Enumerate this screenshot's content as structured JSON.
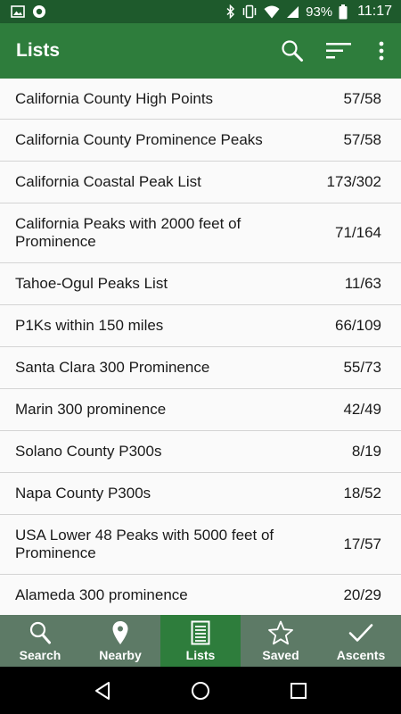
{
  "status_bar": {
    "battery": "93%",
    "time": "11:17"
  },
  "app_bar": {
    "title": "Lists"
  },
  "lists": [
    {
      "name": "California County High Points",
      "count": "57/58"
    },
    {
      "name": "California County Prominence Peaks",
      "count": "57/58"
    },
    {
      "name": "California Coastal Peak List",
      "count": "173/302"
    },
    {
      "name": "California Peaks with 2000 feet of Prominence",
      "count": "71/164"
    },
    {
      "name": "Tahoe-Ogul Peaks List",
      "count": "11/63"
    },
    {
      "name": "P1Ks within 150 miles",
      "count": "66/109"
    },
    {
      "name": "Santa Clara 300 Prominence",
      "count": "55/73"
    },
    {
      "name": "Marin 300 prominence",
      "count": "42/49"
    },
    {
      "name": "Solano County P300s",
      "count": "8/19"
    },
    {
      "name": "Napa County P300s",
      "count": "18/52"
    },
    {
      "name": "USA Lower 48 Peaks with 5000 feet of Prominence",
      "count": "17/57"
    },
    {
      "name": "Alameda 300 prominence",
      "count": "20/29"
    }
  ],
  "bottom_nav": {
    "items": [
      {
        "label": "Search",
        "icon": "search-icon"
      },
      {
        "label": "Nearby",
        "icon": "location-pin-icon"
      },
      {
        "label": "Lists",
        "icon": "list-icon",
        "active": true
      },
      {
        "label": "Saved",
        "icon": "star-icon"
      },
      {
        "label": "Ascents",
        "icon": "checkmark-icon"
      }
    ]
  },
  "colors": {
    "status_bar": "#1e5a2c",
    "app_bar": "#2e7d3c",
    "bottom_nav": "#5d7a66",
    "bottom_nav_active": "#2e7d3c"
  }
}
